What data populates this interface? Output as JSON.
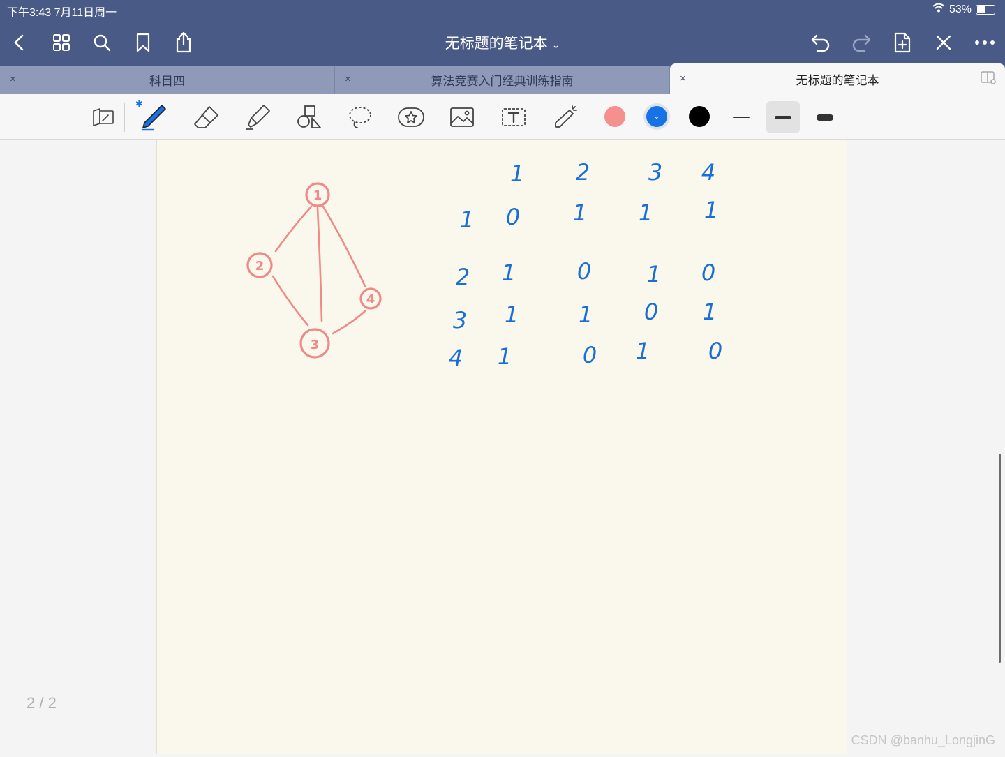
{
  "status": {
    "time_date": "下午3:43   7月11日周一",
    "battery": "53%",
    "battery_level": 0.53
  },
  "nav": {
    "title": "无标题的笔记本",
    "title_chevron": "⌄"
  },
  "tabs": [
    {
      "label": "科目四",
      "close": "×"
    },
    {
      "label": "算法竞赛入门经典训练指南",
      "close": "×"
    },
    {
      "label": "无标题的笔记本",
      "close": "×"
    }
  ],
  "toolbar": {
    "bluetooth_glyph": "✱"
  },
  "colors": {
    "nav_bg": "#4a5a86",
    "swatch_pink": "#f4918f",
    "swatch_blue": "#1673e6",
    "swatch_black": "#000000",
    "ink_blue": "#1a6fd6",
    "ink_pink": "#ef8a86"
  },
  "graph": {
    "nodes": [
      "1",
      "2",
      "3",
      "4"
    ]
  },
  "matrix": {
    "col_headers": [
      "1",
      "2",
      "3",
      "4"
    ],
    "rows": [
      {
        "label": "1",
        "values": [
          "0",
          "1",
          "1",
          "1"
        ]
      },
      {
        "label": "2",
        "values": [
          "1",
          "0",
          "1",
          "0"
        ]
      },
      {
        "label": "3",
        "values": [
          "1",
          "1",
          "0",
          "1"
        ]
      },
      {
        "label": "4",
        "values": [
          "1",
          "0",
          "1",
          "0"
        ]
      }
    ]
  },
  "page_indicator": "2 / 2",
  "watermark": "CSDN @banhu_LongjinG"
}
